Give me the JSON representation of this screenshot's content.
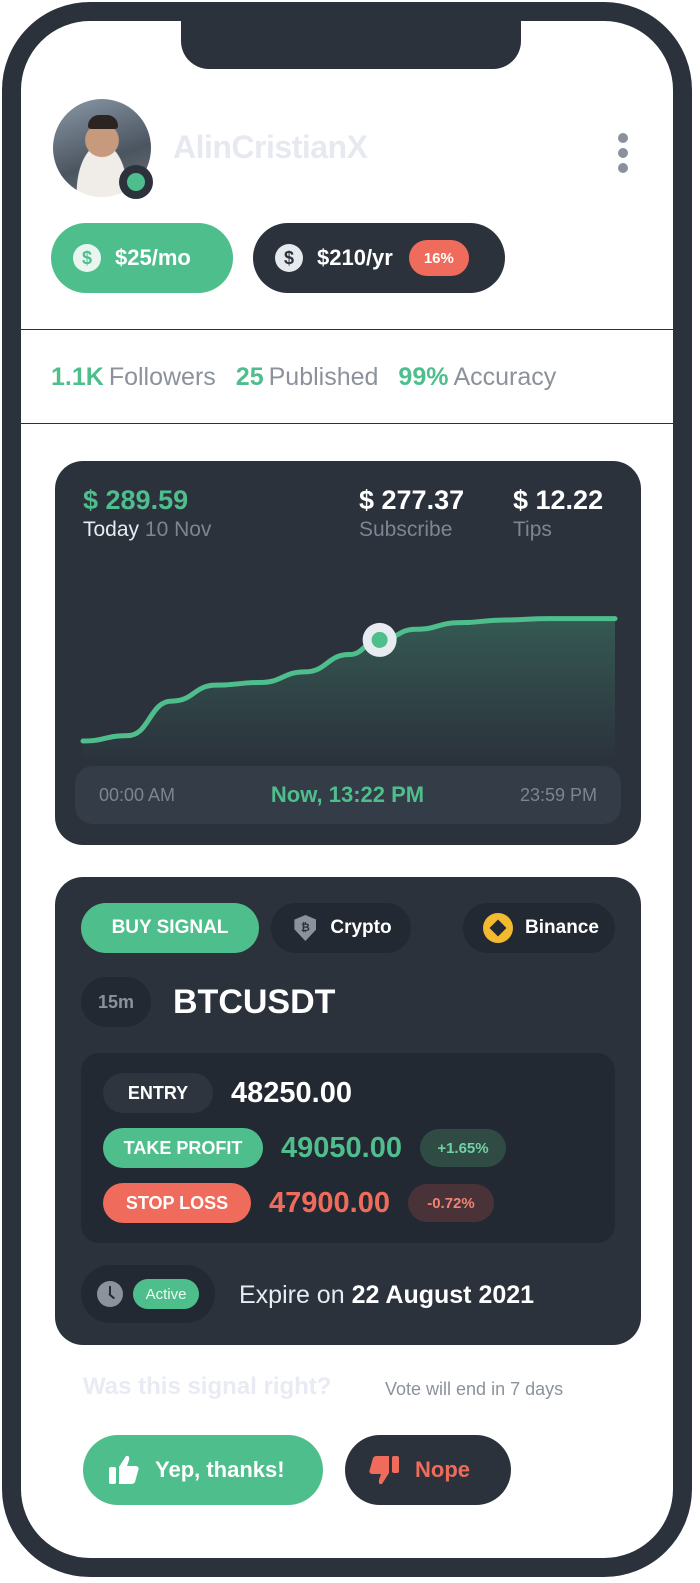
{
  "profile": {
    "username": "AlinCristianX"
  },
  "pricing": {
    "monthly": "$25/mo",
    "yearly": "$210/yr",
    "discount": "16%",
    "currency_symbol": "$"
  },
  "stats": [
    {
      "value": "1.1K",
      "label": "Followers"
    },
    {
      "value": "25",
      "label": "Published"
    },
    {
      "value": "99%",
      "label": "Accuracy"
    }
  ],
  "earnings": {
    "today_value": "$ 289.59",
    "today_label": "Today",
    "today_date": "10 Nov",
    "subscribe_value": "$ 277.37",
    "subscribe_label": "Subscribe",
    "tips_value": "$ 12.22",
    "tips_label": "Tips",
    "time_start": "00:00 AM",
    "time_now": "Now, 13:22 PM",
    "time_end": "23:59 PM"
  },
  "chart_data": {
    "type": "area",
    "x": [
      0,
      2,
      4,
      6,
      8,
      10,
      12,
      13.37,
      15,
      17,
      19,
      21,
      23.98
    ],
    "values": [
      0,
      4,
      30,
      42,
      44,
      52,
      65,
      76,
      84,
      89,
      91,
      92,
      92
    ],
    "current_index": 7,
    "title": "",
    "xlabel": "",
    "ylabel": "",
    "grid": false,
    "line_color": "#4fbe8d"
  },
  "signal": {
    "type_label": "BUY SIGNAL",
    "market_label": "Crypto",
    "exchange_label": "Binance",
    "timeframe": "15m",
    "pair": "BTCUSDT",
    "entry_label": "ENTRY",
    "entry_value": "48250.00",
    "tp_label": "TAKE PROFIT",
    "tp_value": "49050.00",
    "tp_pct": "+1.65%",
    "sl_label": "STOP LOSS",
    "sl_value": "47900.00",
    "sl_pct": "-0.72%",
    "status": "Active",
    "expire_prefix": "Expire on",
    "expire_date": "22 August 2021"
  },
  "vote": {
    "question": "Was this signal right?",
    "note": "Vote will end in 7 days",
    "yes_label": "Yep, thanks!",
    "no_label": "Nope"
  },
  "colors": {
    "accent": "#4fbe8d",
    "danger": "#ef6b5b",
    "card": "#2b323c"
  }
}
